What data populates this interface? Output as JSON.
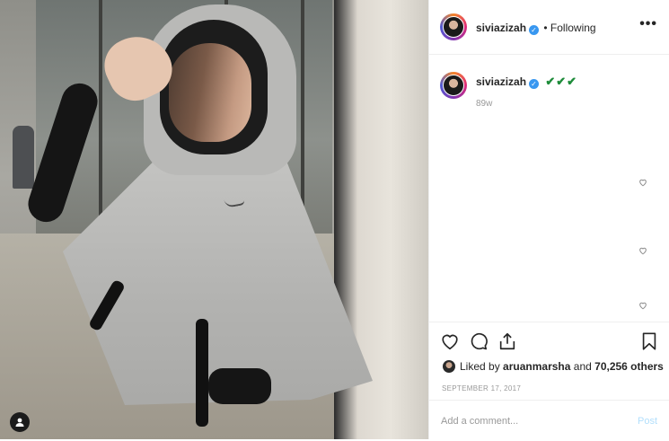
{
  "post": {
    "author": "siviazizah",
    "follow_status": "• Following",
    "more_label": "•••"
  },
  "caption": {
    "author": "siviazizah",
    "text": "✔✔✔",
    "time": "89w"
  },
  "actions": {
    "liked_by_prefix": "Liked by",
    "liked_by_user": "aruanmarsha",
    "liked_by_and": "and",
    "likes_count": "70,256 others",
    "date": "SEPTEMBER 17, 2017"
  },
  "comment_box": {
    "placeholder": "Add a comment...",
    "post_label": "Post"
  },
  "colors": {
    "verified": "#3897f0",
    "checks": "#1e8c3a",
    "post_disabled": "#b2dffc"
  }
}
